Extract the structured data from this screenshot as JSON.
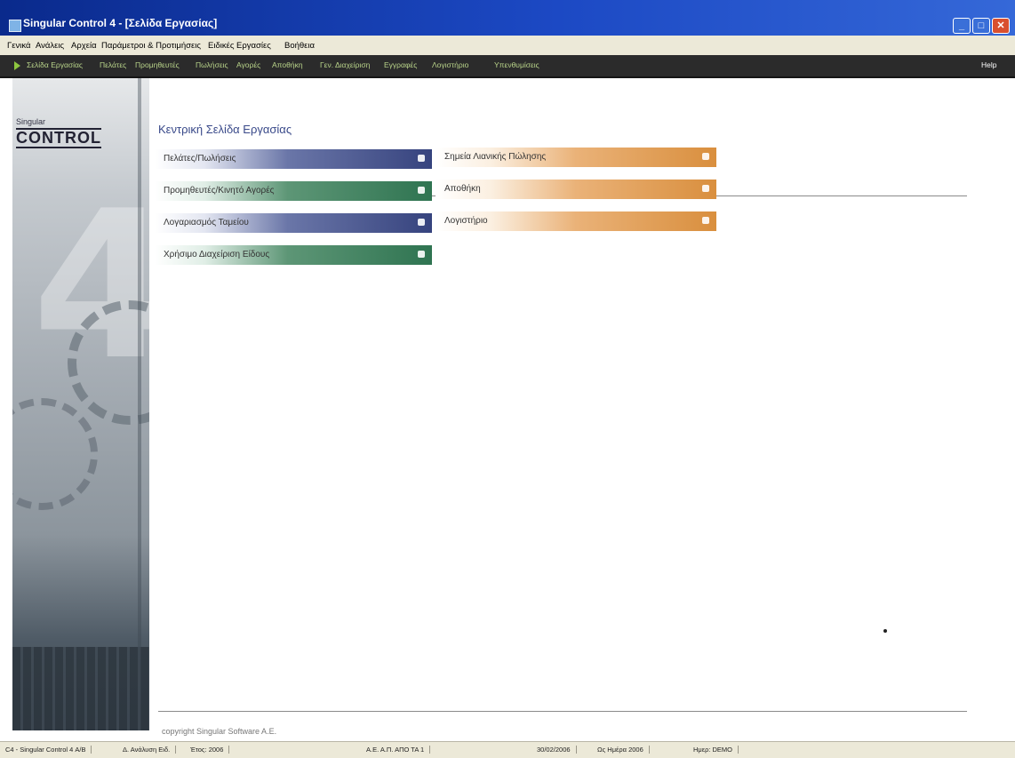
{
  "window": {
    "title": "Singular Control 4 - [Σελίδα Εργασίας]"
  },
  "menubar": [
    "Γενικά",
    "Ανάλεις",
    "Αρχεία",
    "Παράμετροι & Προτιμήσεις",
    "Ειδικές Εργασίες",
    "Βοήθεια"
  ],
  "toolbar": {
    "items": [
      "Σελίδα Εργασίας",
      "Πελάτες",
      "Προμηθευτές",
      "Πωλήσεις",
      "Αγορές",
      "Αποθήκη",
      "Γεν. Διαχείριση",
      "Εγγραφές",
      "Λογιστήριο",
      "Υπενθυμίσεις"
    ],
    "help_label": "Help"
  },
  "sidebar": {
    "logo_small": "Singular",
    "logo_main": "CONTROL",
    "logo_number": "4"
  },
  "main": {
    "title": "Κεντρική Σελίδα Εργασίας",
    "left_tiles": [
      {
        "label": "Πελάτες/Πωλήσεις",
        "color": "#36437e"
      },
      {
        "label": "Προμηθευτές/Κινητό Αγορές",
        "color": "#2f7451"
      },
      {
        "label": "Λογαριασμός Ταμείου",
        "color": "#36437e"
      },
      {
        "label": "Χρήσιμο Διαχείριση Είδους",
        "color": "#2f7451"
      }
    ],
    "right_tiles": [
      {
        "label": "Σημεία Λιανικής Πώλησης",
        "color": "#d98f3e"
      },
      {
        "label": "Αποθήκη",
        "color": "#d98f3e"
      },
      {
        "label": "Λογιστήριο",
        "color": "#d98f3e"
      }
    ],
    "copyright": "copyright Singular Software A.E."
  },
  "statusbar": [
    "C4 - Singular Control 4 Α/Β",
    "Δ. Ανάλυση Ειδ.",
    "Έτος: 2006",
    "Α.Ε. Α.Π. ΑΠΟ ΤΑ 1",
    "30/02/2006",
    "Ως Ημέρα 2006",
    "Ημερ: DEMO"
  ]
}
